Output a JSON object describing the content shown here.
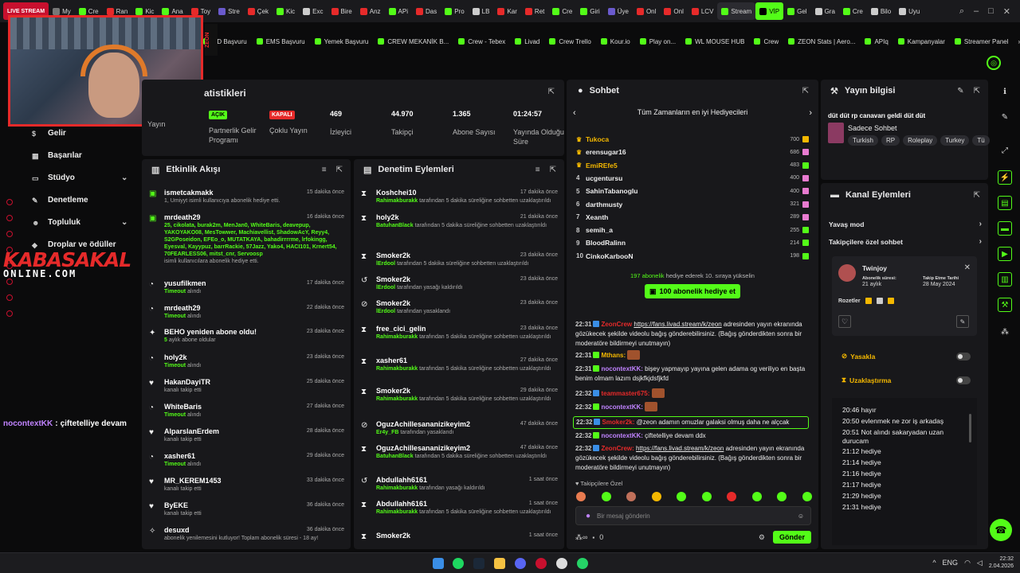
{
  "tabs": [
    {
      "label": "LIVE STREAM",
      "style": "live",
      "color": "#c8102e"
    },
    {
      "label": "My",
      "color": "#777"
    },
    {
      "label": "Cre",
      "color": "#53fc18"
    },
    {
      "label": "Ran",
      "color": "#e62a2a"
    },
    {
      "label": "Kic",
      "color": "#53fc18"
    },
    {
      "label": "Ana",
      "color": "#53fc18"
    },
    {
      "label": "Toy",
      "color": "#e62a2a"
    },
    {
      "label": "Stre",
      "color": "#6a5acd"
    },
    {
      "label": "Çek",
      "color": "#e62a2a"
    },
    {
      "label": "Kic",
      "color": "#53fc18"
    },
    {
      "label": "Exc",
      "color": "#ccc"
    },
    {
      "label": "Bire",
      "color": "#e62a2a"
    },
    {
      "label": "Anz",
      "color": "#e62a2a"
    },
    {
      "label": "APi",
      "color": "#53fc18"
    },
    {
      "label": "Das",
      "color": "#e62a2a"
    },
    {
      "label": "Pro",
      "color": "#53fc18"
    },
    {
      "label": "LB",
      "color": "#ccc"
    },
    {
      "label": "Kar",
      "color": "#e62a2a"
    },
    {
      "label": "Ret",
      "color": "#e62a2a"
    },
    {
      "label": "Cre",
      "color": "#53fc18"
    },
    {
      "label": "Giri",
      "color": "#53fc18"
    },
    {
      "label": "Üye",
      "color": "#6a5acd"
    },
    {
      "label": "Onl",
      "color": "#e62a2a"
    },
    {
      "label": "Onl",
      "color": "#e62a2a"
    },
    {
      "label": "LCV",
      "color": "#e62a2a"
    },
    {
      "label": "Stream",
      "style": "active",
      "color": "#53fc18"
    },
    {
      "label": "VİP",
      "style": "kstream",
      "color": "#000"
    },
    {
      "label": "Gel",
      "color": "#53fc18"
    },
    {
      "label": "Gra",
      "color": "#ccc"
    },
    {
      "label": "Cre",
      "color": "#53fc18"
    },
    {
      "label": "Bilo",
      "color": "#ccc"
    },
    {
      "label": "Uyu",
      "color": "#ccc"
    }
  ],
  "bookmarks": [
    "PD Başvuru",
    "EMS Başvuru",
    "Yemek Başvuru",
    "CREW MEKANİK B...",
    "Crew - Tebex",
    "Livad",
    "Crew Trello",
    "Kour.io",
    "Play on...",
    "WL MOUSE HUB",
    "Crew",
    "ZEON Stats | Aero...",
    "APIq",
    "Kampanyalar",
    "Streamer Panel"
  ],
  "bookmarks_more": "»",
  "webcam_brand": "ZEON",
  "nav": [
    {
      "label": "Gelir",
      "icon": "$",
      "chev": false
    },
    {
      "label": "Başarılar",
      "icon": "▦",
      "chev": false
    },
    {
      "label": "Stüdyo",
      "icon": "▭",
      "chev": true
    },
    {
      "label": "Denetleme",
      "icon": "✎",
      "chev": false
    },
    {
      "label": "Topluluk",
      "icon": "☻",
      "chev": true
    },
    {
      "label": "Droplar ve ödüller",
      "icon": "◆",
      "chev": false
    }
  ],
  "watermark": {
    "line1": "KABASAKAL",
    "line2": "ONLINE.COM"
  },
  "overlay_chat": {
    "user": "nocontextKK",
    "text": "çiftetelliye devam"
  },
  "stats": {
    "title": "atistikleri",
    "items": [
      {
        "value": "",
        "label": "Yayın"
      },
      {
        "badge": "AÇIK",
        "label": "Partnerlik Gelir Programı"
      },
      {
        "badge": "KAPALI",
        "label": "Çoklu Yayın"
      },
      {
        "value": "469",
        "label": "İzleyici"
      },
      {
        "value": "44.970",
        "label": "Takipçi"
      },
      {
        "value": "1.365",
        "label": "Abone Sayısı"
      },
      {
        "value": "01:24:57",
        "label": "Yayında Olduğu Süre"
      }
    ]
  },
  "activity": {
    "title": "Etkinlik Akışı",
    "items": [
      {
        "name": "ismetcakmakk",
        "time": "15 dakika önce",
        "sub": "1, Umiyyt isimli kullanıcıya abonelik hediye etti.",
        "icon": "gift"
      },
      {
        "name": "mrdeath29",
        "time": "16 dakika önce",
        "sub_list": "25, cikolata, burak2m, MenJan0, WhiteBaris, deavepup, YAKOYAKO08, MesTowwer, Machiavellist, ShadowAcY, Reyy4, S2GPoseidon, EFEo_o, MUTATKAYA, bahadirrrrme, lrfokingg, Eyesval, Kayypuz, barrRackie, 57Jazz, Yako4, HACI101, Krnert54, 70FEARLESS06, mitst_cnr, Servoosp",
        "sub": "isimli kullanıcılara abonelik hediye etti.",
        "icon": "gift"
      },
      {
        "name": "yusufilkmen",
        "time": "17 dakika önce",
        "sub_g": "Timeout",
        "sub": "alındı",
        "icon": "time"
      },
      {
        "name": "mrdeath29",
        "time": "22 dakika önce",
        "sub_g": "Timeout",
        "sub": "alındı",
        "icon": "time"
      },
      {
        "name": "BEHO yeniden abone oldu!",
        "time": "23 dakika önce",
        "sub_g": "5",
        "sub": "aylık abone oldular",
        "icon": "star"
      },
      {
        "name": "holy2k",
        "time": "23 dakika önce",
        "sub_g": "Timeout",
        "sub": "alındı",
        "icon": "time"
      },
      {
        "name": "HakanDayiTR",
        "time": "25 dakika önce",
        "sub": "kanalı takip etti",
        "icon": "heart"
      },
      {
        "name": "WhiteBaris",
        "time": "27 dakika önce",
        "sub_g": "Timeout",
        "sub": "alındı",
        "icon": "time"
      },
      {
        "name": "AlparslanErdem",
        "time": "28 dakika önce",
        "sub": "kanalı takip etti",
        "icon": "heart"
      },
      {
        "name": "xasher61",
        "time": "29 dakika önce",
        "sub_g": "Timeout",
        "sub": "alındı",
        "icon": "time"
      },
      {
        "name": "MR_KEREM1453",
        "time": "33 dakika önce",
        "sub": "kanalı takip etti",
        "icon": "heart"
      },
      {
        "name": "ByEKE",
        "time": "36 dakika önce",
        "sub": "kanalı takip etti",
        "icon": "heart"
      },
      {
        "name": "desuxd",
        "time": "36 dakika önce",
        "sub": "abonelik yenilemesini kutluyor! Toplam abonelik süresi - 18 ay!",
        "icon": "party"
      }
    ]
  },
  "moderation": {
    "title": "Denetim Eylemleri",
    "items": [
      {
        "name": "Koshchei10",
        "time": "17 dakika önce",
        "mod": "Rahimakburakk",
        "sub": "tarafından 5 dakika süreliğine sohbetten uzaklaştırıldı",
        "icon": "hourglass"
      },
      {
        "name": "holy2k",
        "time": "21 dakika önce",
        "mod": "BatuhanBlack",
        "sub": "tarafından 5 dakika süreliğine sohbetten uzaklaştırıldı",
        "icon": "hourglass"
      },
      {
        "name": "Smoker2k",
        "time": "23 dakika önce",
        "mod": "lErdool",
        "sub": "tarafından 5 dakika süreliğine sohbetten uzaklaştırıldı",
        "icon": "hourglass"
      },
      {
        "name": "Smoker2k",
        "time": "23 dakika önce",
        "mod": "lErdool",
        "sub": "tarafından yasağı kaldırıldı",
        "icon": "undo"
      },
      {
        "name": "Smoker2k",
        "time": "23 dakika önce",
        "mod": "lErdool",
        "sub": "tarafından yasaklandı",
        "icon": "ban"
      },
      {
        "name": "free_cici_gelin",
        "time": "23 dakika önce",
        "mod": "Rahimakburakk",
        "sub": "tarafından 5 dakika süreliğine sohbetten uzaklaştırıldı",
        "icon": "hourglass"
      },
      {
        "name": "xasher61",
        "time": "27 dakika önce",
        "mod": "Rahimakburakk",
        "sub": "tarafından 5 dakika süreliğine sohbetten uzaklaştırıldı",
        "icon": "hourglass"
      },
      {
        "name": "Smoker2k",
        "time": "29 dakika önce",
        "mod": "Rahimakburakk",
        "sub": "tarafından 5 dakika süreliğine sohbetten uzaklaştırıldı",
        "icon": "hourglass"
      },
      {
        "name": "OguzAchillesananizikeyim2",
        "time": "47 dakika önce",
        "mod": "Er4y_FB",
        "sub": "tarafından yasaklandı",
        "icon": "ban"
      },
      {
        "name": "OguzAchillesananizikeyim2",
        "time": "47 dakika önce",
        "mod": "BatuhanBlack",
        "sub": "tarafından 5 dakika süreliğine sohbetten uzaklaştırıldı",
        "icon": "hourglass"
      },
      {
        "name": "Abdullahh6161",
        "time": "1 saat önce",
        "mod": "Rahimakburakk",
        "sub": "tarafından yasağı kaldırıldı",
        "icon": "undo"
      },
      {
        "name": "Abdullahh6161",
        "time": "1 saat önce",
        "mod": "Rahimakburakk",
        "sub": "tarafından 5 dakika süreliğine sohbetten uzaklaştırıldı",
        "icon": "hourglass"
      },
      {
        "name": "Smoker2k",
        "time": "1 saat önce",
        "mod": "",
        "sub": "",
        "icon": "hourglass"
      }
    ]
  },
  "chat": {
    "title": "Sohbet",
    "gifters_title": "Tüm Zamanların en iyi Hediyecileri",
    "gifters": [
      {
        "rank": "♛",
        "name": "Tukoca",
        "count": "700",
        "gold": true,
        "color": "#f5b800"
      },
      {
        "rank": "♛",
        "name": "erensugar16",
        "count": "686",
        "gold": false,
        "color": "#e87bd0"
      },
      {
        "rank": "♛",
        "name": "EmiREfe5",
        "count": "483",
        "gold": true,
        "color": "#53fc18"
      },
      {
        "rank": "4",
        "name": "ucgentursu",
        "count": "400",
        "gold": false,
        "color": "#e87bd0"
      },
      {
        "rank": "5",
        "name": "SahinTabanoglu",
        "count": "400",
        "gold": false,
        "color": "#e87bd0"
      },
      {
        "rank": "6",
        "name": "darthmusty",
        "count": "321",
        "gold": false,
        "color": "#e87bd0"
      },
      {
        "rank": "7",
        "name": "Xeanth",
        "count": "289",
        "gold": false,
        "color": "#e87bd0"
      },
      {
        "rank": "8",
        "name": "semih_a",
        "count": "255",
        "gold": false,
        "color": "#53fc18"
      },
      {
        "rank": "9",
        "name": "BloodRalinn",
        "count": "214",
        "gold": false,
        "color": "#53fc18"
      },
      {
        "rank": "10",
        "name": "CinkoKarbooN",
        "count": "198",
        "gold": false,
        "color": "#53fc18"
      }
    ],
    "gift_note_count": "197 abonelik",
    "gift_note": "hediye ederek 10. sıraya yükselin",
    "gift_button": "100 abonelik hediye et",
    "messages": [
      {
        "time": "22:31",
        "user": "ZeonCrew",
        "ucolor": "#e62a2a",
        "link": "https://fans.livad.stream/k/zeon",
        "text": "adresinden yayın ekranında gözükecek şekilde videolu bağış gönderebilirsiniz. (Bağış gönderdikten sonra bir moderatöre bildirmeyi unutmayın)"
      },
      {
        "time": "22:31",
        "user": "Mthans:",
        "ucolor": "#f5b800",
        "text": ""
      },
      {
        "time": "22:31",
        "user": "nocontextKK:",
        "ucolor": "#c083ff",
        "text": "bişey yapmayıp yayına gelen adama og veriliyo en başta benim olmam lazım dsjkfkjdsfjkfd"
      },
      {
        "time": "22:32",
        "user": "teammaster675:",
        "ucolor": "#e62a2a",
        "text": ""
      },
      {
        "time": "22:32",
        "user": "nocontextKK:",
        "ucolor": "#c083ff",
        "text": ""
      },
      {
        "time": "22:32",
        "user": "Smoker2k:",
        "ucolor": "#e62a2a",
        "text": "@zeon adamın omuzlar galaksi olmuş daha ne alçcak",
        "hl": true
      },
      {
        "time": "22:32",
        "user": "nocontextKK:",
        "ucolor": "#c083ff",
        "text": "çiftetelliye devam ddx"
      },
      {
        "time": "22:32",
        "user": "ZeonCrew:",
        "ucolor": "#e62a2a",
        "link": "https://fans.livad.stream/k/zeon",
        "text": "adresinden yayın ekranında gözükecek şekilde videolu bağış gönderebilirsiniz. (Bağış gönderdikten sonra bir moderatöre bildirmeyi unutmayın)"
      }
    ],
    "followers_only": "Takipçilere Özel",
    "placeholder": "Bir mesaj gönderin",
    "points": "0",
    "send": "Gönder"
  },
  "stream_info": {
    "title": "Yayın bilgisi",
    "stream_title": "düt düt rp canavarı geldi düt düt",
    "category": "Sadece Sohbet",
    "tags": [
      "Turkish",
      "RP",
      "Roleplay",
      "Turkey",
      "Tü"
    ]
  },
  "channel_actions": {
    "title": "Kanal Eylemleri",
    "rows": [
      "Yavaş mod",
      "Takipçilere özel sohbet"
    ],
    "user": {
      "name": "Twinjoy",
      "sub_key": "Abonelik süresi:",
      "sub_val": "21 aylık",
      "follow_key": "Takip Etme Tarihi",
      "follow_val": "28 May 2024",
      "badges_label": "Rozetler"
    },
    "ban": "Yasakla",
    "timeout": "Uzaklaştırma",
    "log": [
      "20:46 hayır",
      "20:50 evlenmek ne zor iş arkadaş",
      "20:51 Not alındı sakaryadan uzan durucam",
      "21:12 hediye",
      "21:14 hediye",
      "21:16 hediye",
      "21:17 hediye",
      "21:29 hediye",
      "21:31 hediye"
    ]
  },
  "taskbar": {
    "time": "22:32",
    "date": "2.04.2026",
    "lang": "ENG"
  },
  "colors": {
    "accent": "#53fc18",
    "red": "#e62a2a",
    "gold": "#f5b800",
    "purple": "#c083ff",
    "panel": "#18181b",
    "bg": "#0b0b0c"
  }
}
